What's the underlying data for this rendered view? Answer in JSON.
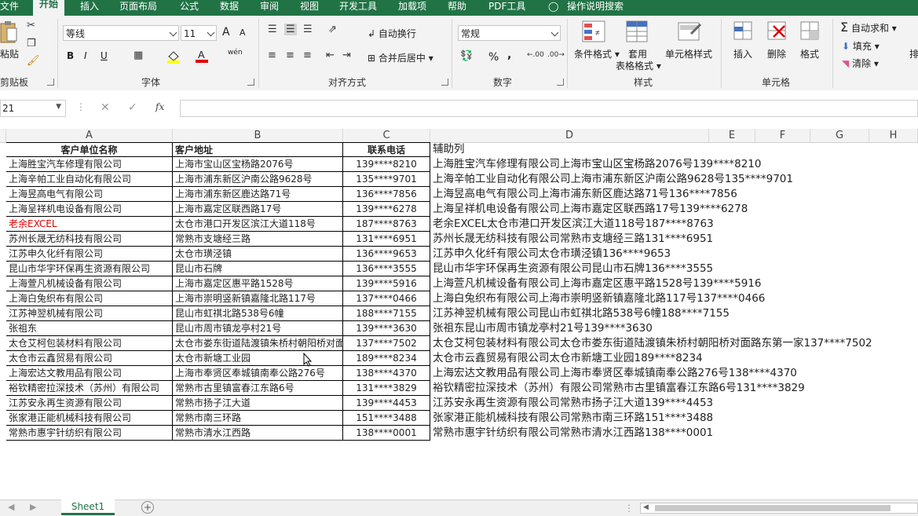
{
  "ribbon_tabs": [
    "文件",
    "开始",
    "插入",
    "页面布局",
    "公式",
    "数据",
    "审阅",
    "视图",
    "开发工具",
    "加载项",
    "帮助",
    "PDF工具",
    "操作说明搜索"
  ],
  "clipboard": {
    "paste": "粘贴",
    "group": "剪贴板"
  },
  "font": {
    "name": "等线",
    "size": "11",
    "bold": "B",
    "italic": "I",
    "underline": "U",
    "group": "字体",
    "grow": "A",
    "shrink": "A",
    "phonetic": "wén"
  },
  "alignment": {
    "wrap": "自动换行",
    "merge": "合并后居中",
    "group": "对齐方式"
  },
  "number": {
    "format": "常规",
    "percent": "%",
    "comma": ",",
    "group": "数字"
  },
  "styles": {
    "conditional": "条件格式",
    "table_line1": "套用",
    "table_line2": "表格格式",
    "cell_styles": "单元格样式",
    "group": "样式"
  },
  "cells": {
    "insert": "插入",
    "delete": "删除",
    "format": "格式",
    "group": "单元格"
  },
  "editing": {
    "autosum": "自动求和",
    "fill": "填充",
    "clear": "清除",
    "sort": "排"
  },
  "formula_bar": {
    "name_box": "21",
    "fx": "fx",
    "content": ""
  },
  "columns": [
    "A",
    "B",
    "C",
    "D",
    "E",
    "F",
    "G",
    "H"
  ],
  "table": {
    "headers": [
      "客户单位名称",
      "客户地址",
      "联系电话",
      "辅助列"
    ],
    "rows": [
      [
        "上海胜宝汽车修理有限公司",
        "上海市宝山区宝杨路2076号",
        "139****8210",
        "上海胜宝汽车修理有限公司上海市宝山区宝杨路2076号139****8210"
      ],
      [
        "上海辛帕工业自动化有限公司",
        "上海市浦东新区沪南公路9628号",
        "135****9701",
        "上海辛帕工业自动化有限公司上海市浦东新区沪南公路9628号135****9701"
      ],
      [
        "上海昱高电气有限公司",
        "上海市浦东新区鹿达路71号",
        "136****7856",
        "上海昱高电气有限公司上海市浦东新区鹿达路71号136****7856"
      ],
      [
        "上海呈祥机电设备有限公司",
        "上海市嘉定区联西路17号",
        "139****6278",
        "上海呈祥机电设备有限公司上海市嘉定区联西路17号139****6278"
      ],
      [
        "老余EXCEL",
        "太仓市港口开发区滨江大道118号",
        "187****8763",
        "老余EXCEL太仓市港口开发区滨江大道118号187****8763"
      ],
      [
        "苏州长晟无纺科技有限公司",
        "常熟市支塘经三路",
        "131****6951",
        "苏州长晟无纺科技有限公司常熟市支塘经三路131****6951"
      ],
      [
        "江苏申久化纤有限公司",
        "太仓市璜泾镇",
        "136****9653",
        "江苏申久化纤有限公司太仓市璜泾镇136****9653"
      ],
      [
        "昆山市华宇环保再生资源有限公司",
        "昆山市石牌",
        "136****3555",
        "昆山市华宇环保再生资源有限公司昆山市石牌136****3555"
      ],
      [
        "上海萱凡机械设备有限公司",
        "上海市嘉定区惠平路1528号",
        "139****5916",
        "上海萱凡机械设备有限公司上海市嘉定区惠平路1528号139****5916"
      ],
      [
        "上海白兔织布有限公司",
        "上海市崇明竖新镇嘉隆北路117号",
        "137****0466",
        "上海白兔织布有限公司上海市崇明竖新镇嘉隆北路117号137****0466"
      ],
      [
        "江苏神翌机械有限公司",
        "昆山市虹祺北路538号6幢",
        "188****7155",
        "江苏神翌机械有限公司昆山市虹祺北路538号6幢188****7155"
      ],
      [
        "张祖东",
        "昆山市周市镇龙亭村21号",
        "139****3630",
        "张祖东昆山市周市镇龙亭村21号139****3630"
      ],
      [
        "太仓艾柯包装材料有限公司",
        "太仓市娄东街道陆渡镇朱桥村朝阳桥对面路东第一家",
        "137****7502",
        "太仓艾柯包装材料有限公司太仓市娄东街道陆渡镇朱桥村朝阳桥对面路东第一家137****7502"
      ],
      [
        "太仓市云鑫贸易有限公司",
        "太仓市新塘工业园",
        "189****8234",
        "太仓市云鑫贸易有限公司太仓市新塘工业园189****8234"
      ],
      [
        "上海宏达文教用品有限公司",
        "上海市奉贤区奉城镇南奉公路276号",
        "138****4370",
        "上海宏达文教用品有限公司上海市奉贤区奉城镇南奉公路276号138****4370"
      ],
      [
        "裕钦精密拉深技术（苏州）有限公司",
        "常熟市古里镇富春江东路6号",
        "131****3829",
        "裕钦精密拉深技术（苏州）有限公司常熟市古里镇富春江东路6号131****3829"
      ],
      [
        "江苏安永再生资源有限公司",
        "常熟市扬子江大道",
        "139****4453",
        "江苏安永再生资源有限公司常熟市扬子江大道139****4453"
      ],
      [
        "张家港正能机械科技有限公司",
        "常熟市南三环路",
        "151****3488",
        "张家港正能机械科技有限公司常熟市南三环路151****3488"
      ],
      [
        "常熟市惠宇针纺织有限公司",
        "常熟市清水江西路",
        "138****0001",
        "常熟市惠宇针纺织有限公司常熟市清水江西路138****0001"
      ]
    ]
  },
  "sheet_tabs": [
    "Sheet1"
  ],
  "colors": {
    "accent": "#217346",
    "red_text": "#e00000"
  }
}
